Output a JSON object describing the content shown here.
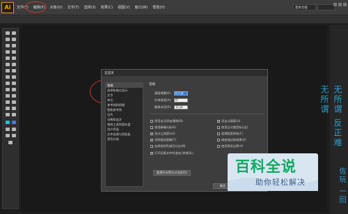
{
  "app": {
    "logo_text": "Ai",
    "brand_color": "#ff9a00"
  },
  "menubar": {
    "items": [
      "文件(F)",
      "编辑(E)",
      "对象(O)",
      "文字(T)",
      "选择(S)",
      "效果(C)",
      "视图(V)",
      "窗口(W)",
      "帮助(H)"
    ],
    "workspace_label": "基本功能"
  },
  "watermark": {
    "vertical_1": "无所谓",
    "vertical_2": "无所谓 反正难",
    "vertical_3": "佐玩 一回"
  },
  "dialog": {
    "title": "首选项",
    "categories": [
      "常规",
      "选择和锚点显示",
      "文字",
      "单位",
      "参考线和网格",
      "智能参考线",
      "切片",
      "词典和连字",
      "增效工具和暂存盘",
      "用户界面",
      "文件处理与剪贴板",
      "黑色外观"
    ],
    "selected_category": "常规",
    "section_title": "常规",
    "fields": [
      {
        "label": "键盘增量(K):",
        "value": "0.3 pt"
      },
      {
        "label": "约束角度(A):",
        "value": "0°"
      },
      {
        "label": "圆角半径(R):",
        "value": "12 pt"
      }
    ],
    "checks_left": [
      {
        "label": "停用自动添加/删除(B)",
        "checked": false
      },
      {
        "label": "使用精确光标(E)",
        "checked": false
      },
      {
        "label": "显示工具提示(I)",
        "checked": true
      },
      {
        "label": "消除锯齿图稿(T)",
        "checked": true
      },
      {
        "label": "选择相同色调百分比(M)",
        "checked": false
      },
      {
        "label": "打开旧版文件时追加 [转换](L)",
        "checked": true
      }
    ],
    "checks_right": [
      {
        "label": "双击以隔离(U)",
        "checked": true
      },
      {
        "label": "使用日式裁剪标记(J)",
        "checked": false
      },
      {
        "label": "变换图案拼贴(F)",
        "checked": false
      },
      {
        "label": "缩放描边和效果(O)",
        "checked": false
      },
      {
        "label": "使用预览边界(V)",
        "checked": false
      }
    ],
    "reset_label": "重置所有警告对话框(D)",
    "ok_label": "确定"
  },
  "baike": {
    "title": "百科全说",
    "subtitle": "助你轻松解决"
  }
}
